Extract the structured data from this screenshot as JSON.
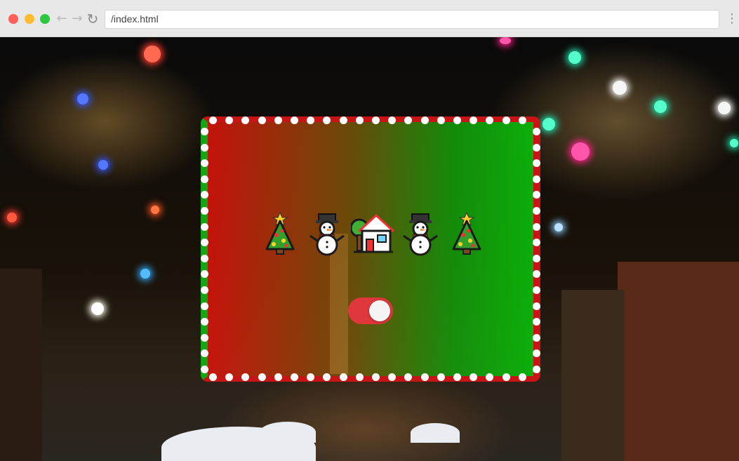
{
  "browser": {
    "url": "/index.html",
    "back_icon": "arrow-left-icon",
    "forward_icon": "arrow-right-icon",
    "reload_icon": "reload-icon",
    "menu_icon": "kebab-menu-icon"
  },
  "card": {
    "gradient_colors": [
      "#dc140a",
      "#785a0a",
      "#14a00a",
      "#0abe0a"
    ],
    "border_colors": {
      "left": "#14a514",
      "right": "#c81414"
    },
    "emojis": [
      {
        "name": "christmas-tree-icon"
      },
      {
        "name": "snowman-icon"
      },
      {
        "name": "house-icon"
      },
      {
        "name": "snowman-icon"
      },
      {
        "name": "christmas-tree-icon"
      }
    ],
    "toggle": {
      "state": "on",
      "color": "#e0373d"
    }
  }
}
